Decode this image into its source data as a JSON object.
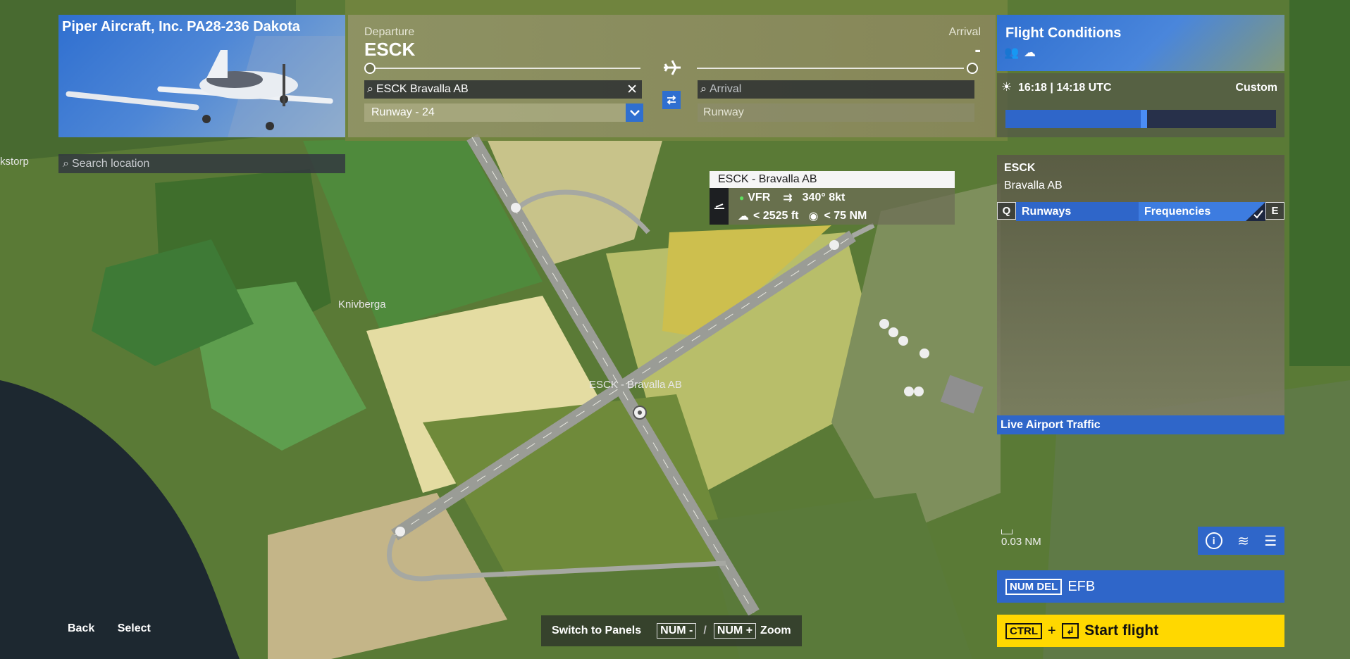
{
  "aircraft": {
    "title": "Piper Aircraft, Inc. PA28-236 Dakota"
  },
  "search": {
    "placeholder": "Search location"
  },
  "route": {
    "departure_label": "Departure",
    "departure_code": "ESCK",
    "arrival_label": "Arrival",
    "arrival_code": "-",
    "departure_search_value": "ESCK Bravalla AB",
    "departure_runway": "Runway - 24",
    "arrival_placeholder": "Arrival",
    "arrival_runway_placeholder": "Runway"
  },
  "conditions": {
    "title": "Flight Conditions",
    "time_local": "16:18",
    "time_separator": "|",
    "time_utc": "14:18 UTC",
    "weather_preset": "Custom",
    "time_of_day_fraction": 0.5
  },
  "airport": {
    "code": "ESCK",
    "name": "Bravalla AB",
    "tab_prev_key": "Q",
    "tab_next_key": "E",
    "tabs": [
      {
        "label": "Runways",
        "selected": false
      },
      {
        "label": "Frequencies",
        "selected": true
      }
    ],
    "live_traffic": "Live Airport Traffic"
  },
  "tooltip": {
    "title": "ESCK - Bravalla AB",
    "flight_rules": "VFR",
    "wind": "340° 8kt",
    "ceiling": "< 2525 ft",
    "visibility": "< 75 NM"
  },
  "map": {
    "airport_label": "ESCK - Bravalla AB",
    "place_label_1": "Knivberga",
    "place_label_2": "kstorp",
    "scale": "0.03 NM"
  },
  "efb": {
    "key": "NUM DEL",
    "label": "EFB"
  },
  "start_flight": {
    "key": "CTRL",
    "plus": "+",
    "label": "Start flight"
  },
  "bottom": {
    "back": "Back",
    "select": "Select",
    "switch_panels": "Switch to Panels",
    "num_minus": "NUM -",
    "slash": "/",
    "num_plus": "NUM +",
    "zoom": "Zoom"
  },
  "colors": {
    "accent": "#2f66c9",
    "start_flight": "#ffd800",
    "vfr": "#5ee05e"
  }
}
